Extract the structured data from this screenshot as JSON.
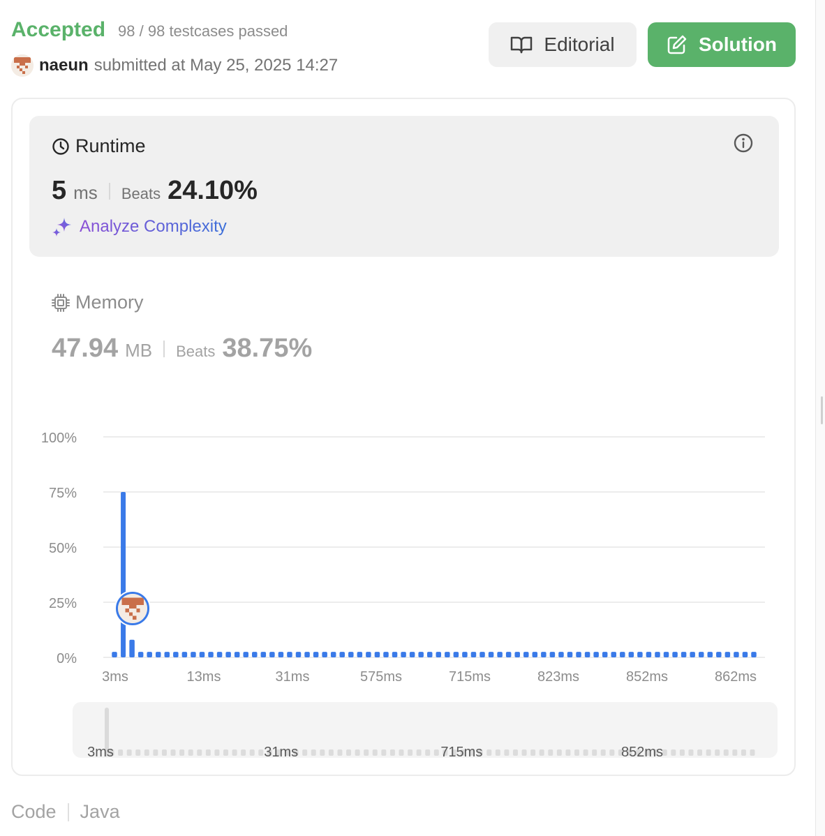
{
  "header": {
    "status": "Accepted",
    "testcases": "98 / 98 testcases passed",
    "username": "naeun",
    "submitted": "submitted at May 25, 2025 14:27",
    "editorial_label": "Editorial",
    "solution_label": "Solution"
  },
  "runtime": {
    "title": "Runtime",
    "value": "5",
    "unit": "ms",
    "beats_label": "Beats",
    "beats_value": "24.10%",
    "analyze_label": "Analyze Complexity"
  },
  "memory": {
    "title": "Memory",
    "value": "47.94",
    "unit": "MB",
    "beats_label": "Beats",
    "beats_value": "38.75%"
  },
  "colors": {
    "accent_green": "#5ab26a",
    "bar_blue": "#3a7ae8",
    "avatar_orange": "#c96f4a"
  },
  "chart_data": {
    "type": "bar",
    "title": "",
    "xlabel": "",
    "ylabel": "",
    "ylim": [
      0,
      100
    ],
    "y_ticks": [
      "100%",
      "75%",
      "50%",
      "25%",
      "0%"
    ],
    "y_tick_values": [
      100,
      75,
      50,
      25,
      0
    ],
    "x_tick_labels": [
      "3ms",
      "13ms",
      "31ms",
      "575ms",
      "715ms",
      "823ms",
      "852ms",
      "862ms"
    ],
    "values": [
      2.5,
      75,
      8,
      2.5,
      2.5,
      2.5,
      2.5,
      2.5,
      2.5,
      2.5,
      2.5,
      2.5,
      2.5,
      2.5,
      2.5,
      2.5,
      2.5,
      2.5,
      2.5,
      2.5,
      2.5,
      2.5,
      2.5,
      2.5,
      2.5,
      2.5,
      2.5,
      2.5,
      2.5,
      2.5,
      2.5,
      2.5,
      2.5,
      2.5,
      2.5,
      2.5,
      2.5,
      2.5,
      2.5,
      2.5,
      2.5,
      2.5,
      2.5,
      2.5,
      2.5,
      2.5,
      2.5,
      2.5,
      2.5,
      2.5,
      2.5,
      2.5,
      2.5,
      2.5,
      2.5,
      2.5,
      2.5,
      2.5,
      2.5,
      2.5,
      2.5,
      2.5,
      2.5,
      2.5,
      2.5,
      2.5,
      2.5,
      2.5,
      2.5,
      2.5,
      2.5,
      2.5,
      2.5,
      2.5
    ],
    "highlight_index": 1,
    "highlight_value": 24.1,
    "grid": true,
    "range_labels": [
      "3ms",
      "31ms",
      "715ms",
      "852ms"
    ]
  },
  "footer": {
    "code_label": "Code",
    "language": "Java"
  }
}
